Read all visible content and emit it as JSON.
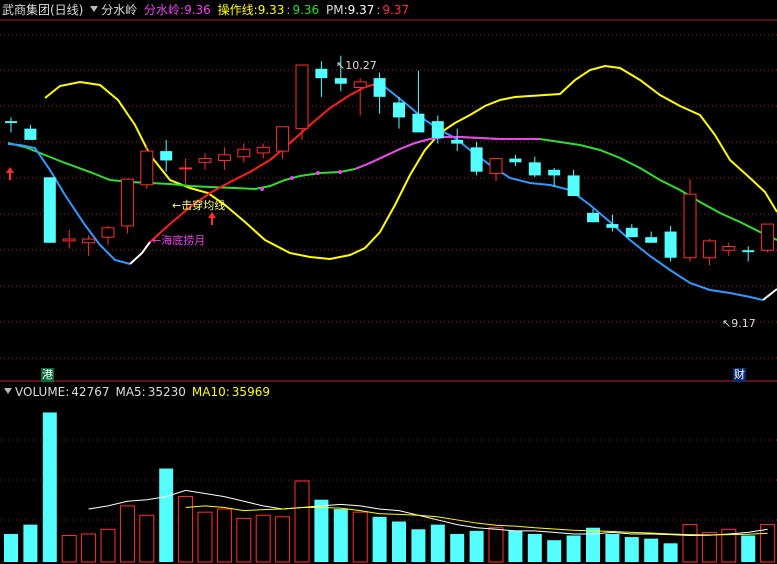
{
  "header": {
    "stock_name": "武商集团(日线)",
    "indicator_name": "分水岭",
    "fsl_label": "分水岭:",
    "fsl_value": "9.36",
    "czx_label": "操作线:",
    "czx_value1": "9.33",
    "czx_value2": "9.36",
    "pm_label": "PM:",
    "pm_value1": "9.37",
    "pm_value2": "9.37"
  },
  "volume_header": {
    "volume_label": "VOLUME:",
    "volume_value": "42767",
    "ma5_label": "MA5:",
    "ma5_value": "35230",
    "ma10_label": "MA10:",
    "ma10_value": "35969"
  },
  "badges": {
    "gang": "港",
    "cai": "财"
  },
  "colors": {
    "up": "#ff3030",
    "down": "#54ffff",
    "yellow": "#ffff00",
    "green": "#30dd30",
    "blue": "#3399ff",
    "red_line": "#ff2020",
    "magenta": "#ee44ee",
    "white": "#ffffff",
    "grid": "#8b1a1a",
    "text_magenta": "#ee44ee",
    "text_yellow": "#ffff00",
    "text_green": "#30dd30",
    "text_red": "#ff3030"
  },
  "chart_data": {
    "type": "candlestick",
    "ylim": [
      8.9,
      10.45
    ],
    "grid": true,
    "candles": [
      {
        "o": 9.92,
        "h": 9.94,
        "l": 9.86,
        "c": 9.91
      },
      {
        "o": 9.88,
        "h": 9.9,
        "l": 9.82,
        "c": 9.82
      },
      {
        "o": 9.62,
        "h": 9.62,
        "l": 9.27,
        "c": 9.27
      },
      {
        "o": 9.28,
        "h": 9.34,
        "l": 9.24,
        "c": 9.29
      },
      {
        "o": 9.27,
        "h": 9.31,
        "l": 9.2,
        "c": 9.29
      },
      {
        "o": 9.3,
        "h": 9.36,
        "l": 9.26,
        "c": 9.35
      },
      {
        "o": 9.36,
        "h": 9.61,
        "l": 9.32,
        "c": 9.61
      },
      {
        "o": 9.58,
        "h": 9.79,
        "l": 9.56,
        "c": 9.76
      },
      {
        "o": 9.76,
        "h": 9.82,
        "l": 9.65,
        "c": 9.71
      },
      {
        "o": 9.67,
        "h": 9.72,
        "l": 9.58,
        "c": 9.67
      },
      {
        "o": 9.7,
        "h": 9.75,
        "l": 9.66,
        "c": 9.72
      },
      {
        "o": 9.71,
        "h": 9.78,
        "l": 9.66,
        "c": 9.74
      },
      {
        "o": 9.73,
        "h": 9.8,
        "l": 9.7,
        "c": 9.77
      },
      {
        "o": 9.75,
        "h": 9.8,
        "l": 9.72,
        "c": 9.78
      },
      {
        "o": 9.76,
        "h": 9.89,
        "l": 9.72,
        "c": 9.89
      },
      {
        "o": 9.88,
        "h": 10.22,
        "l": 9.82,
        "c": 10.22
      },
      {
        "o": 10.2,
        "h": 10.24,
        "l": 10.05,
        "c": 10.15
      },
      {
        "o": 10.15,
        "h": 10.27,
        "l": 10.08,
        "c": 10.12
      },
      {
        "o": 10.1,
        "h": 10.15,
        "l": 9.95,
        "c": 10.13
      },
      {
        "o": 10.15,
        "h": 10.18,
        "l": 9.96,
        "c": 10.05
      },
      {
        "o": 10.02,
        "h": 10.05,
        "l": 9.88,
        "c": 9.94
      },
      {
        "o": 9.96,
        "h": 10.19,
        "l": 9.86,
        "c": 9.86
      },
      {
        "o": 9.92,
        "h": 9.95,
        "l": 9.8,
        "c": 9.83
      },
      {
        "o": 9.82,
        "h": 9.88,
        "l": 9.76,
        "c": 9.8
      },
      {
        "o": 9.78,
        "h": 9.81,
        "l": 9.63,
        "c": 9.65
      },
      {
        "o": 9.64,
        "h": 9.72,
        "l": 9.6,
        "c": 9.72
      },
      {
        "o": 9.72,
        "h": 9.74,
        "l": 9.68,
        "c": 9.7
      },
      {
        "o": 9.7,
        "h": 9.73,
        "l": 9.62,
        "c": 9.63
      },
      {
        "o": 9.66,
        "h": 9.67,
        "l": 9.57,
        "c": 9.63
      },
      {
        "o": 9.63,
        "h": 9.66,
        "l": 9.54,
        "c": 9.52
      },
      {
        "o": 9.43,
        "h": 9.45,
        "l": 9.38,
        "c": 9.38
      },
      {
        "o": 9.37,
        "h": 9.42,
        "l": 9.33,
        "c": 9.35
      },
      {
        "o": 9.35,
        "h": 9.37,
        "l": 9.3,
        "c": 9.3
      },
      {
        "o": 9.3,
        "h": 9.33,
        "l": 9.27,
        "c": 9.27
      },
      {
        "o": 9.33,
        "h": 9.36,
        "l": 9.17,
        "c": 9.19
      },
      {
        "o": 9.19,
        "h": 9.61,
        "l": 9.17,
        "c": 9.53
      },
      {
        "o": 9.19,
        "h": 9.29,
        "l": 9.15,
        "c": 9.28
      },
      {
        "o": 9.23,
        "h": 9.27,
        "l": 9.2,
        "c": 9.25
      },
      {
        "o": 9.23,
        "h": 9.25,
        "l": 9.17,
        "c": 9.22
      },
      {
        "o": 9.23,
        "h": 9.37,
        "l": 9.22,
        "c": 9.37
      }
    ],
    "annotations": {
      "high_label": "10.27",
      "low_label": "9.17",
      "label_jichuan": "←击穿均线",
      "label_haidi": "←海底捞月"
    },
    "volume": {
      "values": [
        9000,
        12000,
        48000,
        8500,
        9000,
        10500,
        18000,
        15000,
        30000,
        21000,
        16000,
        17000,
        14000,
        15000,
        14500,
        26000,
        20000,
        17000,
        16000,
        14500,
        13000,
        10500,
        12000,
        9000,
        10000,
        11000,
        10000,
        9000,
        7000,
        8500,
        11000,
        9000,
        8000,
        7500,
        6000,
        12000,
        9500,
        10500,
        8500,
        12000
      ],
      "ma5": [
        null,
        null,
        null,
        null,
        17000,
        18000,
        19500,
        20000,
        21000,
        23000,
        22000,
        21000,
        19500,
        18000,
        17000,
        17500,
        18000,
        18500,
        18000,
        17000,
        16500,
        15000,
        13500,
        12000,
        11000,
        10500,
        10000,
        10000,
        9500,
        9000,
        9000,
        9500,
        9000,
        9000,
        8800,
        8500,
        8600,
        9000,
        9500,
        10500
      ],
      "ma10": [
        null,
        null,
        null,
        null,
        null,
        null,
        null,
        null,
        null,
        17500,
        18000,
        17500,
        16500,
        16800,
        17000,
        17500,
        17500,
        17300,
        16500,
        15500,
        15300,
        15000,
        14500,
        13500,
        12500,
        11800,
        11500,
        11000,
        10600,
        10200,
        10000,
        9800,
        9500,
        9300,
        9000,
        8800,
        8700,
        8800,
        8900,
        9200
      ],
      "ylim": [
        0,
        52000
      ]
    }
  }
}
